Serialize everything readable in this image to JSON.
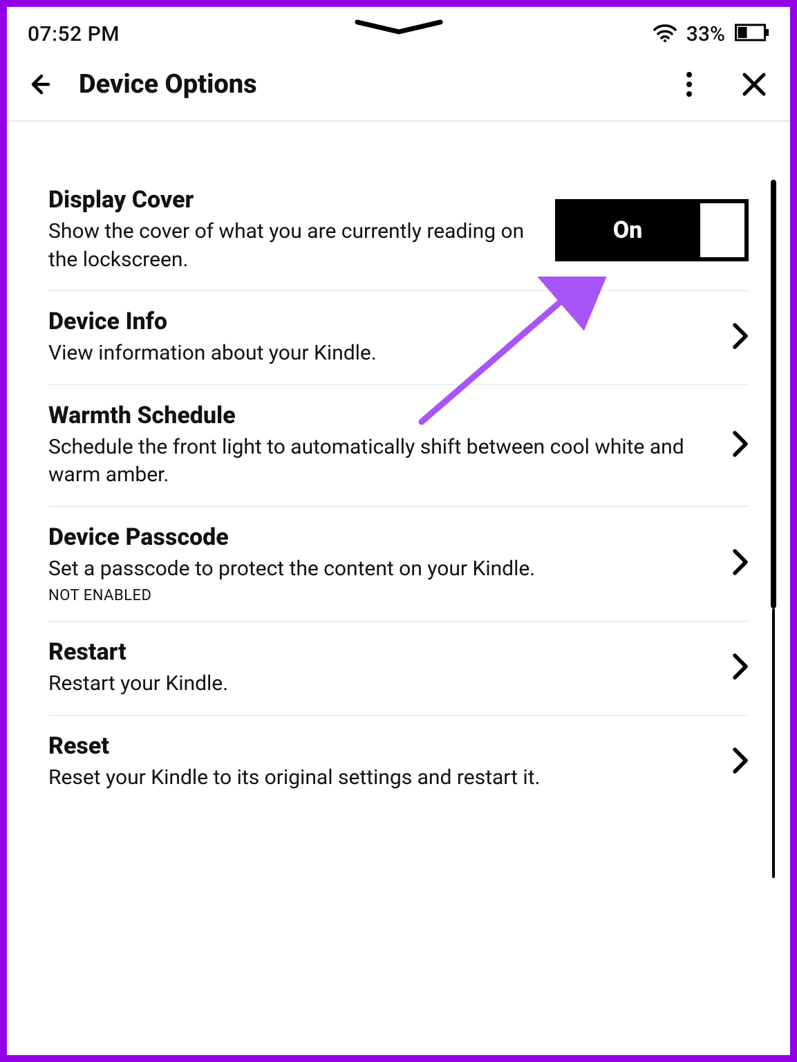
{
  "statusbar": {
    "time": "07:52 PM",
    "battery_percent": "33%"
  },
  "header": {
    "title": "Device Options"
  },
  "toggle": {
    "display_cover_state": "On"
  },
  "rows": {
    "display_cover": {
      "title": "Display Cover",
      "desc": "Show the cover of what you are currently reading on the lockscreen."
    },
    "device_info": {
      "title": "Device Info",
      "desc": "View information about your Kindle."
    },
    "warmth_schedule": {
      "title": "Warmth Schedule",
      "desc": "Schedule the front light to automatically shift between cool white and warm amber."
    },
    "device_passcode": {
      "title": "Device Passcode",
      "desc": "Set a passcode to protect the content on your Kindle.",
      "note": "NOT ENABLED"
    },
    "restart": {
      "title": "Restart",
      "desc": "Restart your Kindle."
    },
    "reset": {
      "title": "Reset",
      "desc": "Reset your Kindle to its original settings and restart it."
    }
  },
  "annotation": {
    "arrow_color": "#a855f7"
  }
}
